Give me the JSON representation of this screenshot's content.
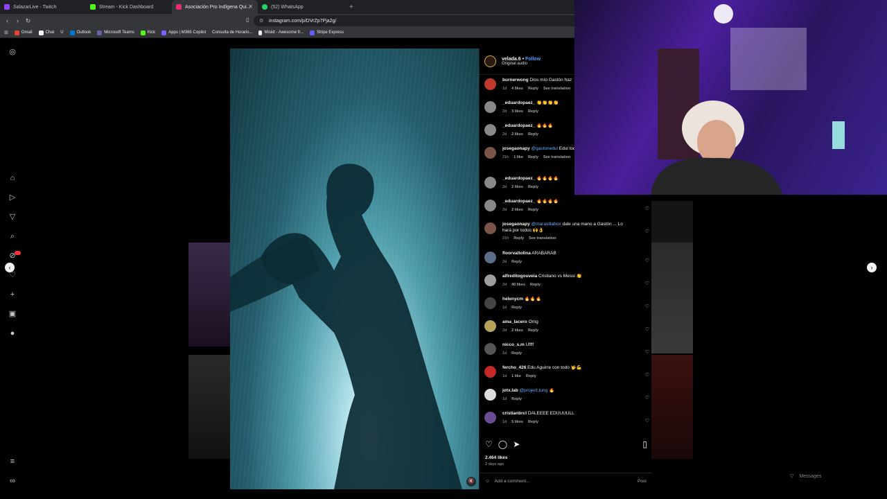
{
  "tabs": [
    {
      "label": "SalazarLive - Twitch",
      "color": "#9146ff",
      "active": false
    },
    {
      "label": "Stream - Kick Dashboard",
      "color": "#53fc18",
      "active": false
    },
    {
      "label": "Asociación Pro Indígena Qui...",
      "color": "#e1306c",
      "active": true
    },
    {
      "label": "(52) WhatsApp",
      "color": "#25d366",
      "active": false
    }
  ],
  "url": "instagram.com/p/DVrZp7Pja2g/",
  "bookmarks": [
    "Gmail",
    "Chat",
    "U",
    "Outlook",
    "Microsoft Teams",
    "Kick",
    "Apps | M365 Copilot",
    "Consulta de Horario...",
    "Miskit - Awesome fr...",
    "Stripe Express"
  ],
  "post": {
    "author": "velada.6",
    "follow_label": "Follow",
    "audio": "Original audio",
    "likes": "2.464 likes",
    "age": "2 days ago",
    "add_comment_placeholder": "Add a comment...",
    "post_label": "Post"
  },
  "comments": [
    {
      "user": "burnerwong",
      "text": "Dios mío Gastón haz",
      "age": "1d",
      "likes": "4 likes",
      "reply": "Reply",
      "translate": "See translation",
      "avatar": "#c0392b"
    },
    {
      "user": "_eduardopaez_",
      "text": "👏👏👏👏",
      "age": "2d",
      "likes": "3 likes",
      "reply": "Reply",
      "translate": "",
      "avatar": "#888888"
    },
    {
      "user": "_eduardopaez_",
      "text": "🔥🔥🔥",
      "age": "2d",
      "likes": "2 likes",
      "reply": "Reply",
      "translate": "",
      "avatar": "#888888"
    },
    {
      "user": "josegaonapy",
      "text": "Edul toda latinoamer",
      "mention": "@gastonedul",
      "mention_tail": "🙌👌",
      "age": "21h",
      "likes": "1 like",
      "reply": "Reply",
      "translate": "See translation",
      "avatar": "#7a5548"
    },
    {
      "user": "_eduardopaez_",
      "text": "🔥🔥🔥🔥",
      "age": "2d",
      "likes": "2 likes",
      "reply": "Reply",
      "translate": "",
      "avatar": "#888888"
    },
    {
      "user": "_eduardopaez_",
      "text": "🔥🔥🔥🔥",
      "age": "2d",
      "likes": "2 likes",
      "reply": "Reply",
      "translate": "",
      "avatar": "#888888"
    },
    {
      "user": "josegaonapy",
      "text": "dale una mano a Gastón ... Lo hará por todos 🙌👌",
      "mention": "@maravillabox",
      "age": "21h",
      "likes": "",
      "reply": "Reply",
      "translate": "See translation",
      "avatar": "#7a5548"
    },
    {
      "user": "floorvaltolina",
      "text": "ARABARAB",
      "age": "2d",
      "likes": "",
      "reply": "Reply",
      "translate": "",
      "avatar": "#5d6d8a"
    },
    {
      "user": "alfreditogouveia",
      "text": "Cristiano vs Messi 👏",
      "age": "2d",
      "likes": "40 likes",
      "reply": "Reply",
      "translate": "",
      "avatar": "#9e9e9e"
    },
    {
      "user": "helenycm",
      "text": "🔥🔥🔥",
      "age": "1d",
      "likes": "",
      "reply": "Reply",
      "translate": "",
      "avatar": "#444444"
    },
    {
      "user": "ama_lacero",
      "text": "Omg",
      "age": "2d",
      "likes": "2 likes",
      "reply": "Reply",
      "translate": "",
      "avatar": "#b7a25a"
    },
    {
      "user": "nicco_s.m",
      "text": "Uffff",
      "age": "1d",
      "likes": "",
      "reply": "Reply",
      "translate": "",
      "avatar": "#555555"
    },
    {
      "user": "fercho_426",
      "text": "Edu Aguirre con todo 🤟💪",
      "age": "1d",
      "likes": "1 like",
      "reply": "Reply",
      "translate": "",
      "avatar": "#c62828"
    },
    {
      "user": "jotx.lab",
      "text": "🔥",
      "mention": "@project.tung",
      "age": "1d",
      "likes": "",
      "reply": "Reply",
      "translate": "",
      "avatar": "#dddddd"
    },
    {
      "user": "cristianbrcl",
      "text": "DALEEEE EDUUUULL",
      "age": "1d",
      "likes": "5 likes",
      "reply": "Reply",
      "translate": "",
      "avatar": "#6a4c93"
    }
  ],
  "overlay": {
    "messages_label": "Messages"
  }
}
